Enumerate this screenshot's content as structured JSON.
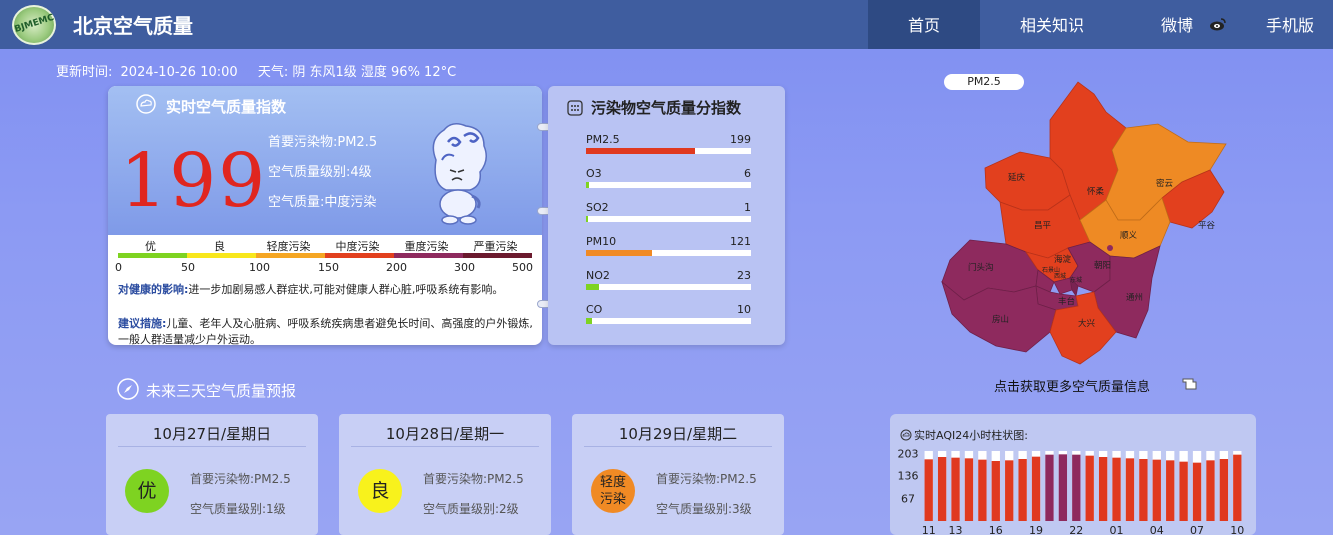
{
  "header": {
    "site_title": "北京空气质量",
    "nav": [
      {
        "label": "首页",
        "active": true
      },
      {
        "label": "相关知识",
        "active": false
      },
      {
        "label": "微博",
        "active": false
      },
      {
        "label": "手机版",
        "active": false
      }
    ],
    "logo_text": "BJMEMC"
  },
  "update": {
    "label": "更新时间:",
    "time": "2024-10-26 10:00",
    "weather_label": "天气:",
    "weather": "阴 东风1级 湿度 96% 12°C"
  },
  "aqi": {
    "title": "实时空气质量指数",
    "value": "199",
    "primary_pollutant": "首要污染物:PM2.5",
    "level": "空气质量级别:4级",
    "quality": "空气质量:中度污染",
    "scale_labels": [
      "优",
      "良",
      "轻度污染",
      "中度污染",
      "重度污染",
      "严重污染"
    ],
    "scale_numbers": [
      "0",
      "50",
      "100",
      "150",
      "200",
      "300",
      "500"
    ],
    "scale_colors": [
      "#7ed321",
      "#f8e71c",
      "#f5a623",
      "#e2401e",
      "#8e2a5e",
      "#6b1a2e"
    ],
    "health_label": "对健康的影响:",
    "health_text": "进一步加剧易感人群症状,可能对健康人群心脏,呼吸系统有影响。",
    "advice_label": "建议措施:",
    "advice_text": "儿童、老年人及心脏病、呼吸系统疾病患者避免长时间、高强度的户外锻炼,一般人群适量减少户外运动。"
  },
  "pollutants": {
    "title": "污染物空气质量分指数",
    "items": [
      {
        "name": "PM2.5",
        "value": "199",
        "fraction": 0.66,
        "color": "#e0391f"
      },
      {
        "name": "O3",
        "value": "6",
        "fraction": 0.02,
        "color": "#7ed321"
      },
      {
        "name": "SO2",
        "value": "1",
        "fraction": 0.005,
        "color": "#7ed321"
      },
      {
        "name": "PM10",
        "value": "121",
        "fraction": 0.4,
        "color": "#f08a24"
      },
      {
        "name": "NO2",
        "value": "23",
        "fraction": 0.08,
        "color": "#7ed321"
      },
      {
        "name": "CO",
        "value": "10",
        "fraction": 0.035,
        "color": "#7ed321"
      }
    ]
  },
  "forecast": {
    "title": "未来三天空气质量预报",
    "days": [
      {
        "date": "10月27日/星期日",
        "badge": "优",
        "badge_color": "#7ed321",
        "primary": "首要污染物:PM2.5",
        "level": "空气质量级别:1级"
      },
      {
        "date": "10月28日/星期一",
        "badge": "良",
        "badge_color": "#f8f21c",
        "primary": "首要污染物:PM2.5",
        "level": "空气质量级别:2级"
      },
      {
        "date": "10月29日/星期二",
        "badge": "轻度污染",
        "badge_color": "#f08a24",
        "primary": "首要污染物:PM2.5",
        "level": "空气质量级别:3级"
      }
    ]
  },
  "map": {
    "tip": "PM2.5",
    "hint": "点击获取更多空气质量信息",
    "districts": [
      "延庆",
      "怀柔",
      "密云",
      "昌平",
      "平谷",
      "顺义",
      "门头沟",
      "海淀",
      "朝阳",
      "石景山",
      "丰台",
      "通州",
      "房山",
      "大兴",
      "西城",
      "东城"
    ]
  },
  "chart_data": {
    "type": "bar",
    "title": "实时AQI24小时柱状图:",
    "y_ticks": [
      "203",
      "136",
      "67"
    ],
    "ylim": [
      0,
      210
    ],
    "x_tick_labels": [
      "11",
      "13",
      "16",
      "19",
      "22",
      "01",
      "04",
      "07",
      "10"
    ],
    "categories": [
      "11",
      "12",
      "13",
      "14",
      "15",
      "16",
      "17",
      "18",
      "19",
      "20",
      "21",
      "22",
      "23",
      "00",
      "01",
      "02",
      "03",
      "04",
      "05",
      "06",
      "07",
      "08",
      "09",
      "10"
    ],
    "values": [
      185,
      192,
      190,
      188,
      184,
      180,
      182,
      186,
      193,
      199,
      200,
      199,
      196,
      192,
      190,
      188,
      186,
      184,
      182,
      178,
      175,
      182,
      186,
      199
    ],
    "colors": [
      "#e0391f",
      "#e0391f",
      "#e0391f",
      "#e0391f",
      "#e0391f",
      "#e0391f",
      "#e0391f",
      "#e0391f",
      "#e0391f",
      "#8e2a5e",
      "#8e2a5e",
      "#8e2a5e",
      "#e0391f",
      "#e0391f",
      "#e0391f",
      "#e0391f",
      "#e0391f",
      "#e0391f",
      "#e0391f",
      "#e0391f",
      "#e0391f",
      "#e0391f",
      "#e0391f",
      "#e0391f"
    ]
  }
}
